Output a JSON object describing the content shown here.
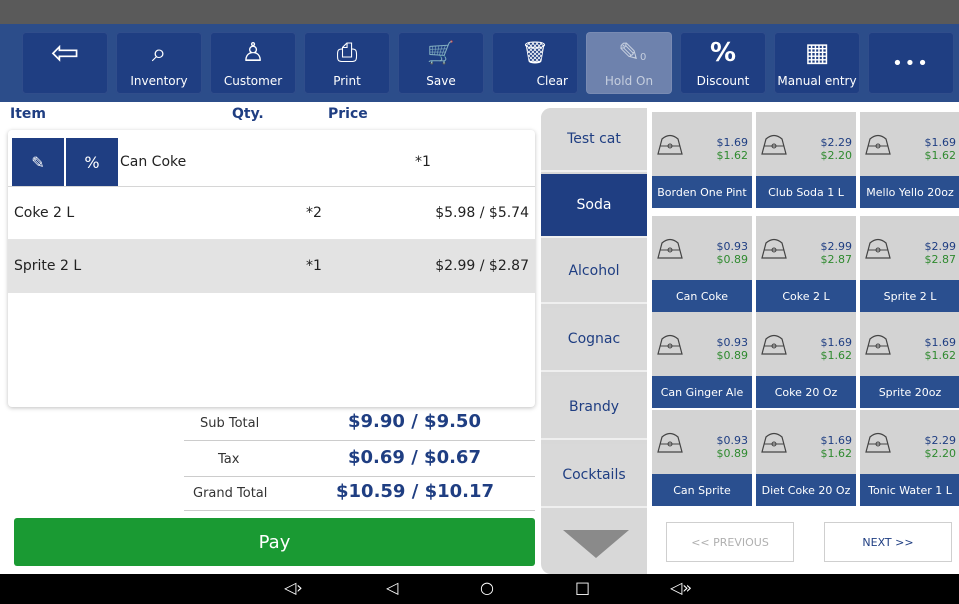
{
  "toolbar": {
    "buttons": [
      {
        "label": "",
        "icon": "back-arrow-icon",
        "glyph": "⇦"
      },
      {
        "label": "Inventory",
        "icon": "search-icon",
        "glyph": "⌕"
      },
      {
        "label": "Customer",
        "icon": "user-add-icon",
        "glyph": "♙"
      },
      {
        "label": "Print",
        "icon": "printer-icon",
        "glyph": "⎙"
      },
      {
        "label": "Save",
        "icon": "cart-icon",
        "glyph": "🛒"
      },
      {
        "label": "Clear",
        "icon": "trash-icon",
        "glyph": "🗑"
      },
      {
        "label": "Hold On",
        "icon": "pin-icon",
        "glyph": "✎",
        "badge": "0"
      },
      {
        "label": "Discount",
        "icon": "percent-icon",
        "glyph": "%"
      },
      {
        "label": "Manual entry",
        "icon": "calculator-icon",
        "glyph": "▦"
      },
      {
        "label": "",
        "icon": "more-icon",
        "glyph": "•••"
      }
    ]
  },
  "order": {
    "headers": {
      "item": "Item",
      "qty": "Qty.",
      "price": "Price"
    },
    "rows": [
      {
        "item": "Can Coke",
        "qty": "*1",
        "price": ""
      },
      {
        "item": "Coke 2 L",
        "qty": "*2",
        "price": "$5.98 / $5.74"
      },
      {
        "item": "Sprite 2 L",
        "qty": "*1",
        "price": "$2.99 / $2.87"
      }
    ],
    "edit_glyph": "✎",
    "percent_glyph": "%"
  },
  "totals": {
    "subtotal_label": "Sub Total",
    "subtotal_value": "$9.90 / $9.50",
    "tax_label": "Tax",
    "tax_value": "$0.69 / $0.67",
    "grand_label": "Grand Total",
    "grand_value": "$10.59 / $10.17"
  },
  "pay_label": "Pay",
  "categories": [
    "Test cat",
    "Soda",
    "Alcohol",
    "Cognac",
    "Brandy",
    "Cocktails"
  ],
  "active_category": "Soda",
  "products": [
    {
      "name": "Borden One Pint",
      "p1": "$1.69",
      "p2": "$1.62"
    },
    {
      "name": "Club Soda 1 L",
      "p1": "$2.29",
      "p2": "$2.20"
    },
    {
      "name": "Mello Yello 20oz",
      "p1": "$1.69",
      "p2": "$1.62"
    },
    {
      "name": "Can Coke",
      "p1": "$0.93",
      "p2": "$0.89"
    },
    {
      "name": "Coke 2 L",
      "p1": "$2.99",
      "p2": "$2.87"
    },
    {
      "name": "Sprite 2 L",
      "p1": "$2.99",
      "p2": "$2.87"
    },
    {
      "name": "Can Ginger Ale",
      "p1": "$0.93",
      "p2": "$0.89"
    },
    {
      "name": "Coke 20 Oz",
      "p1": "$1.69",
      "p2": "$1.62"
    },
    {
      "name": "Sprite 20oz",
      "p1": "$1.69",
      "p2": "$1.62"
    },
    {
      "name": "Can Sprite",
      "p1": "$0.93",
      "p2": "$0.89"
    },
    {
      "name": "Diet Coke 20 Oz",
      "p1": "$1.69",
      "p2": "$1.62"
    },
    {
      "name": "Tonic Water 1 L",
      "p1": "$2.29",
      "p2": "$2.20"
    }
  ],
  "pagination": {
    "prev": "<< PREVIOUS",
    "next": "NEXT >>"
  },
  "navbar": {
    "vol_down": "◁›",
    "back": "◁",
    "home": "○",
    "recents": "□",
    "vol_up": "◁»"
  },
  "colors": {
    "brand": "#1f3e82",
    "pay": "#1a9a33",
    "tile_label": "#2a4f8f"
  }
}
